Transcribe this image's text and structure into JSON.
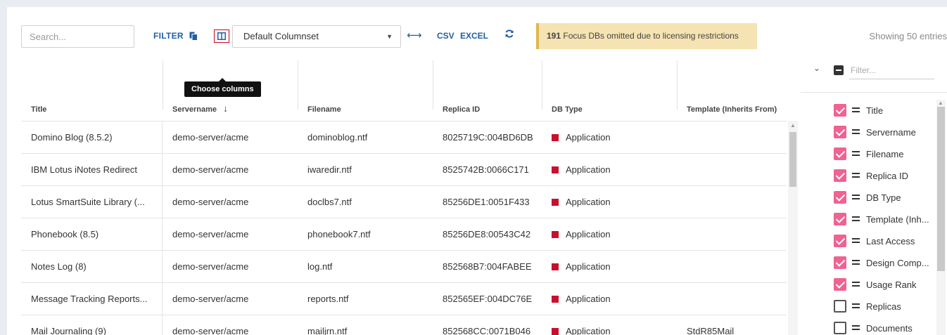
{
  "toolbar": {
    "search_placeholder": "Search...",
    "filter_label": "FILTER",
    "columnset_value": "Default Columnset",
    "csv_label": "CSV",
    "excel_label": "EXCEL",
    "banner_count": "191",
    "banner_text": " Focus DBs omitted due to licensing restrictions",
    "showing": "Showing 50 entries",
    "tooltip": "Choose columns"
  },
  "table": {
    "headers": [
      "Title",
      "Servername",
      "Filename",
      "Replica ID",
      "DB Type",
      "Template (Inherits From)"
    ],
    "rows": [
      [
        "Domino Blog (8.5.2)",
        "demo-server/acme",
        "dominoblog.ntf",
        "8025719C:004BD6DB",
        "Application",
        ""
      ],
      [
        "IBM Lotus iNotes Redirect",
        "demo-server/acme",
        "iwaredir.ntf",
        "8525742B:0066C171",
        "Application",
        ""
      ],
      [
        "Lotus SmartSuite Library (...",
        "demo-server/acme",
        "doclbs7.ntf",
        "85256DE1:0051F433",
        "Application",
        ""
      ],
      [
        "Phonebook (8.5)",
        "demo-server/acme",
        "phonebook7.ntf",
        "85256DE8:00543C42",
        "Application",
        ""
      ],
      [
        "Notes Log (8)",
        "demo-server/acme",
        "log.ntf",
        "852568B7:004FABEE",
        "Application",
        ""
      ],
      [
        "Message Tracking Reports...",
        "demo-server/acme",
        "reports.ntf",
        "852565EF:004DC76E",
        "Application",
        ""
      ],
      [
        "Mail Journaling (9)",
        "demo-server/acme",
        "mailjrn.ntf",
        "852568CC:0071B046",
        "Application",
        "StdR85Mail"
      ]
    ],
    "dbtype_color": "#c8102e"
  },
  "sidebar": {
    "filter_placeholder": "Filter...",
    "columns": [
      {
        "name": "Title",
        "checked": true
      },
      {
        "name": "Servername",
        "checked": true
      },
      {
        "name": "Filename",
        "checked": true
      },
      {
        "name": "Replica ID",
        "checked": true
      },
      {
        "name": "DB Type",
        "checked": true
      },
      {
        "name": "Template (Inh...",
        "checked": true
      },
      {
        "name": "Last Access",
        "checked": true
      },
      {
        "name": "Design Comp...",
        "checked": true
      },
      {
        "name": "Usage Rank",
        "checked": true
      },
      {
        "name": "Replicas",
        "checked": false
      },
      {
        "name": "Documents",
        "checked": false
      }
    ],
    "accent_color": "#f06292"
  }
}
